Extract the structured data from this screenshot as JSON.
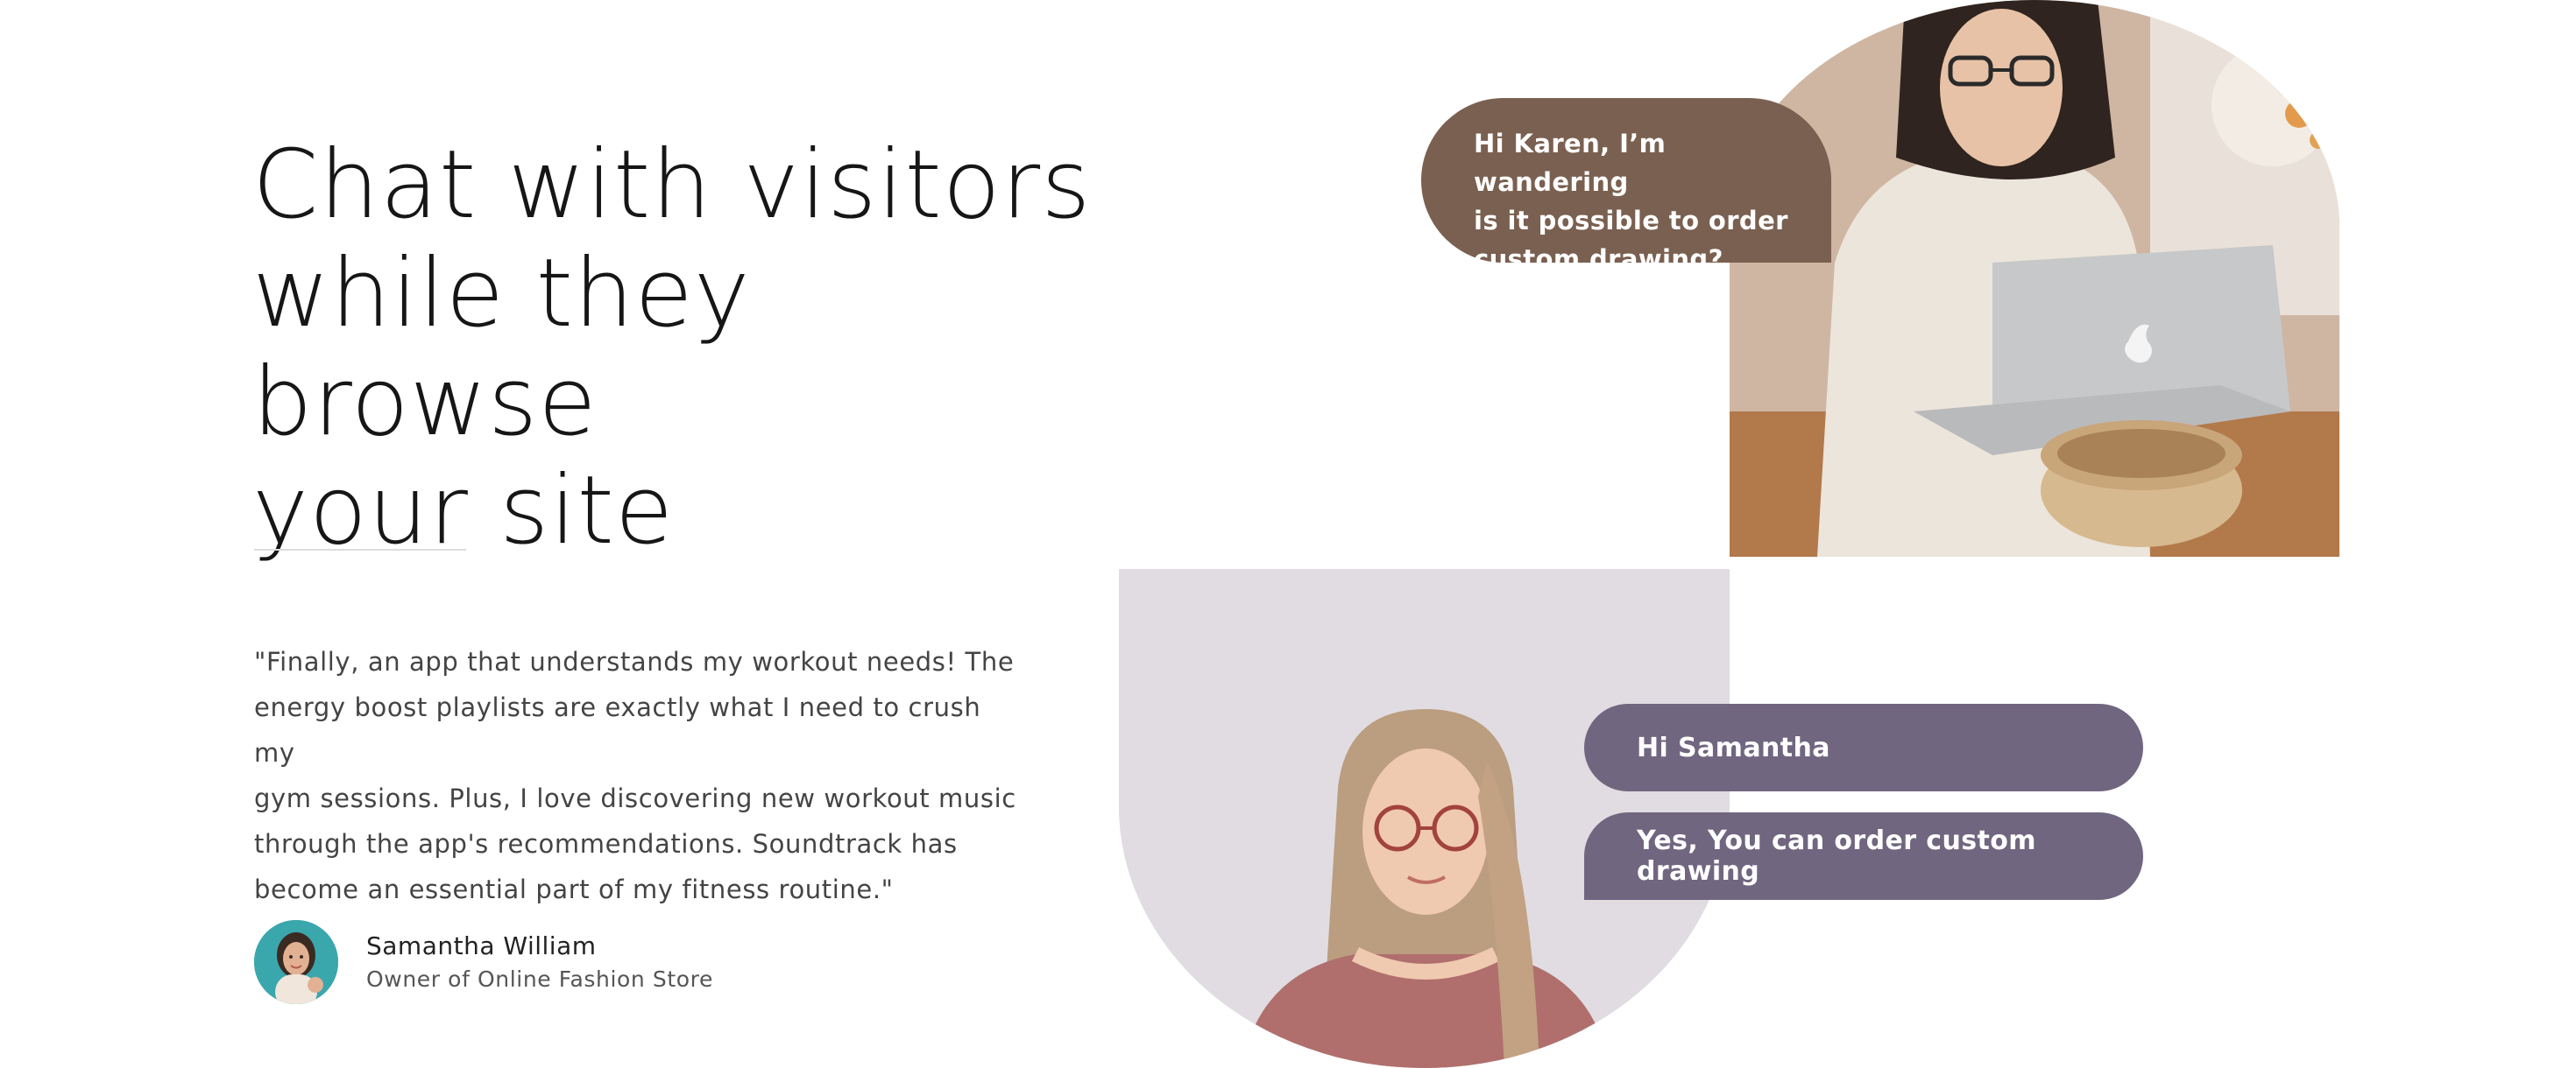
{
  "hero": {
    "headline_line1": "Chat with visitors",
    "headline_line2": "while they browse",
    "headline_line3": "your site"
  },
  "testimonial": {
    "quote_line1": "\"Finally, an app that understands my workout needs! The",
    "quote_line2": "energy boost playlists are exactly what I need to crush my",
    "quote_line3": "gym sessions. Plus, I love discovering new workout music",
    "quote_line4": "through the app's recommendations. Soundtrack has",
    "quote_line5": "become an essential part of my fitness routine.\"",
    "author_name": "Samantha William",
    "author_role": "Owner of Online Fashion Store"
  },
  "chat": {
    "visitor_message_line1": "Hi Karen, I’m wandering",
    "visitor_message_line2": "is it possible to order",
    "visitor_message_line3": "custom drawing?",
    "reply_1": "Hi Samantha",
    "reply_2": "Yes, You can order custom drawing"
  },
  "colors": {
    "visitor_bubble": "#7a6050",
    "reply_bubble": "#716680",
    "avatar_bg": "#3aa7ad",
    "headline_text": "#161616"
  }
}
